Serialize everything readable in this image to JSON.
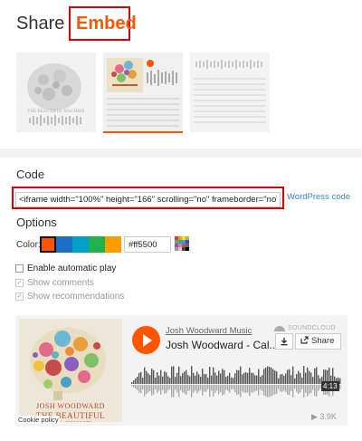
{
  "tabs": {
    "share": "Share",
    "embed": "Embed"
  },
  "code": {
    "title": "Code",
    "embed_code": "<iframe width=\"100%\" height=\"166\" scrolling=\"no\" frameborder=\"no\" allow=\"autoplay\"",
    "wordpress_link": "WordPress code"
  },
  "options": {
    "title": "Options",
    "color_label": "Color:",
    "swatch_colors": [
      "#ff5500",
      "#1a6fc4",
      "#00a0c8",
      "#22b24c",
      "#ff9c00"
    ],
    "selected_color": "#ff5500",
    "color_value": "#ff5500",
    "checkboxes": [
      {
        "label": "Enable automatic play",
        "checked": false,
        "enabled": true
      },
      {
        "label": "Show comments",
        "checked": true,
        "enabled": false
      },
      {
        "label": "Show recommendations",
        "checked": true,
        "enabled": false
      }
    ]
  },
  "player": {
    "artist": "Josh Woodward Music",
    "track": "Josh Woodward - Cal...",
    "brand": "SOUNDCLOUD",
    "share_label": "Share",
    "download_icon": "download-icon",
    "duration": "4:13",
    "plays": "▶ 3.9K",
    "artwork_line1": "JOSH WOODWARD",
    "artwork_line2": "THE BEAUTIFUL MACHINE",
    "cookie_policy": "Cookie policy"
  },
  "thumbs": {
    "caption": "THE BEAUTIFUL MACHINE"
  }
}
